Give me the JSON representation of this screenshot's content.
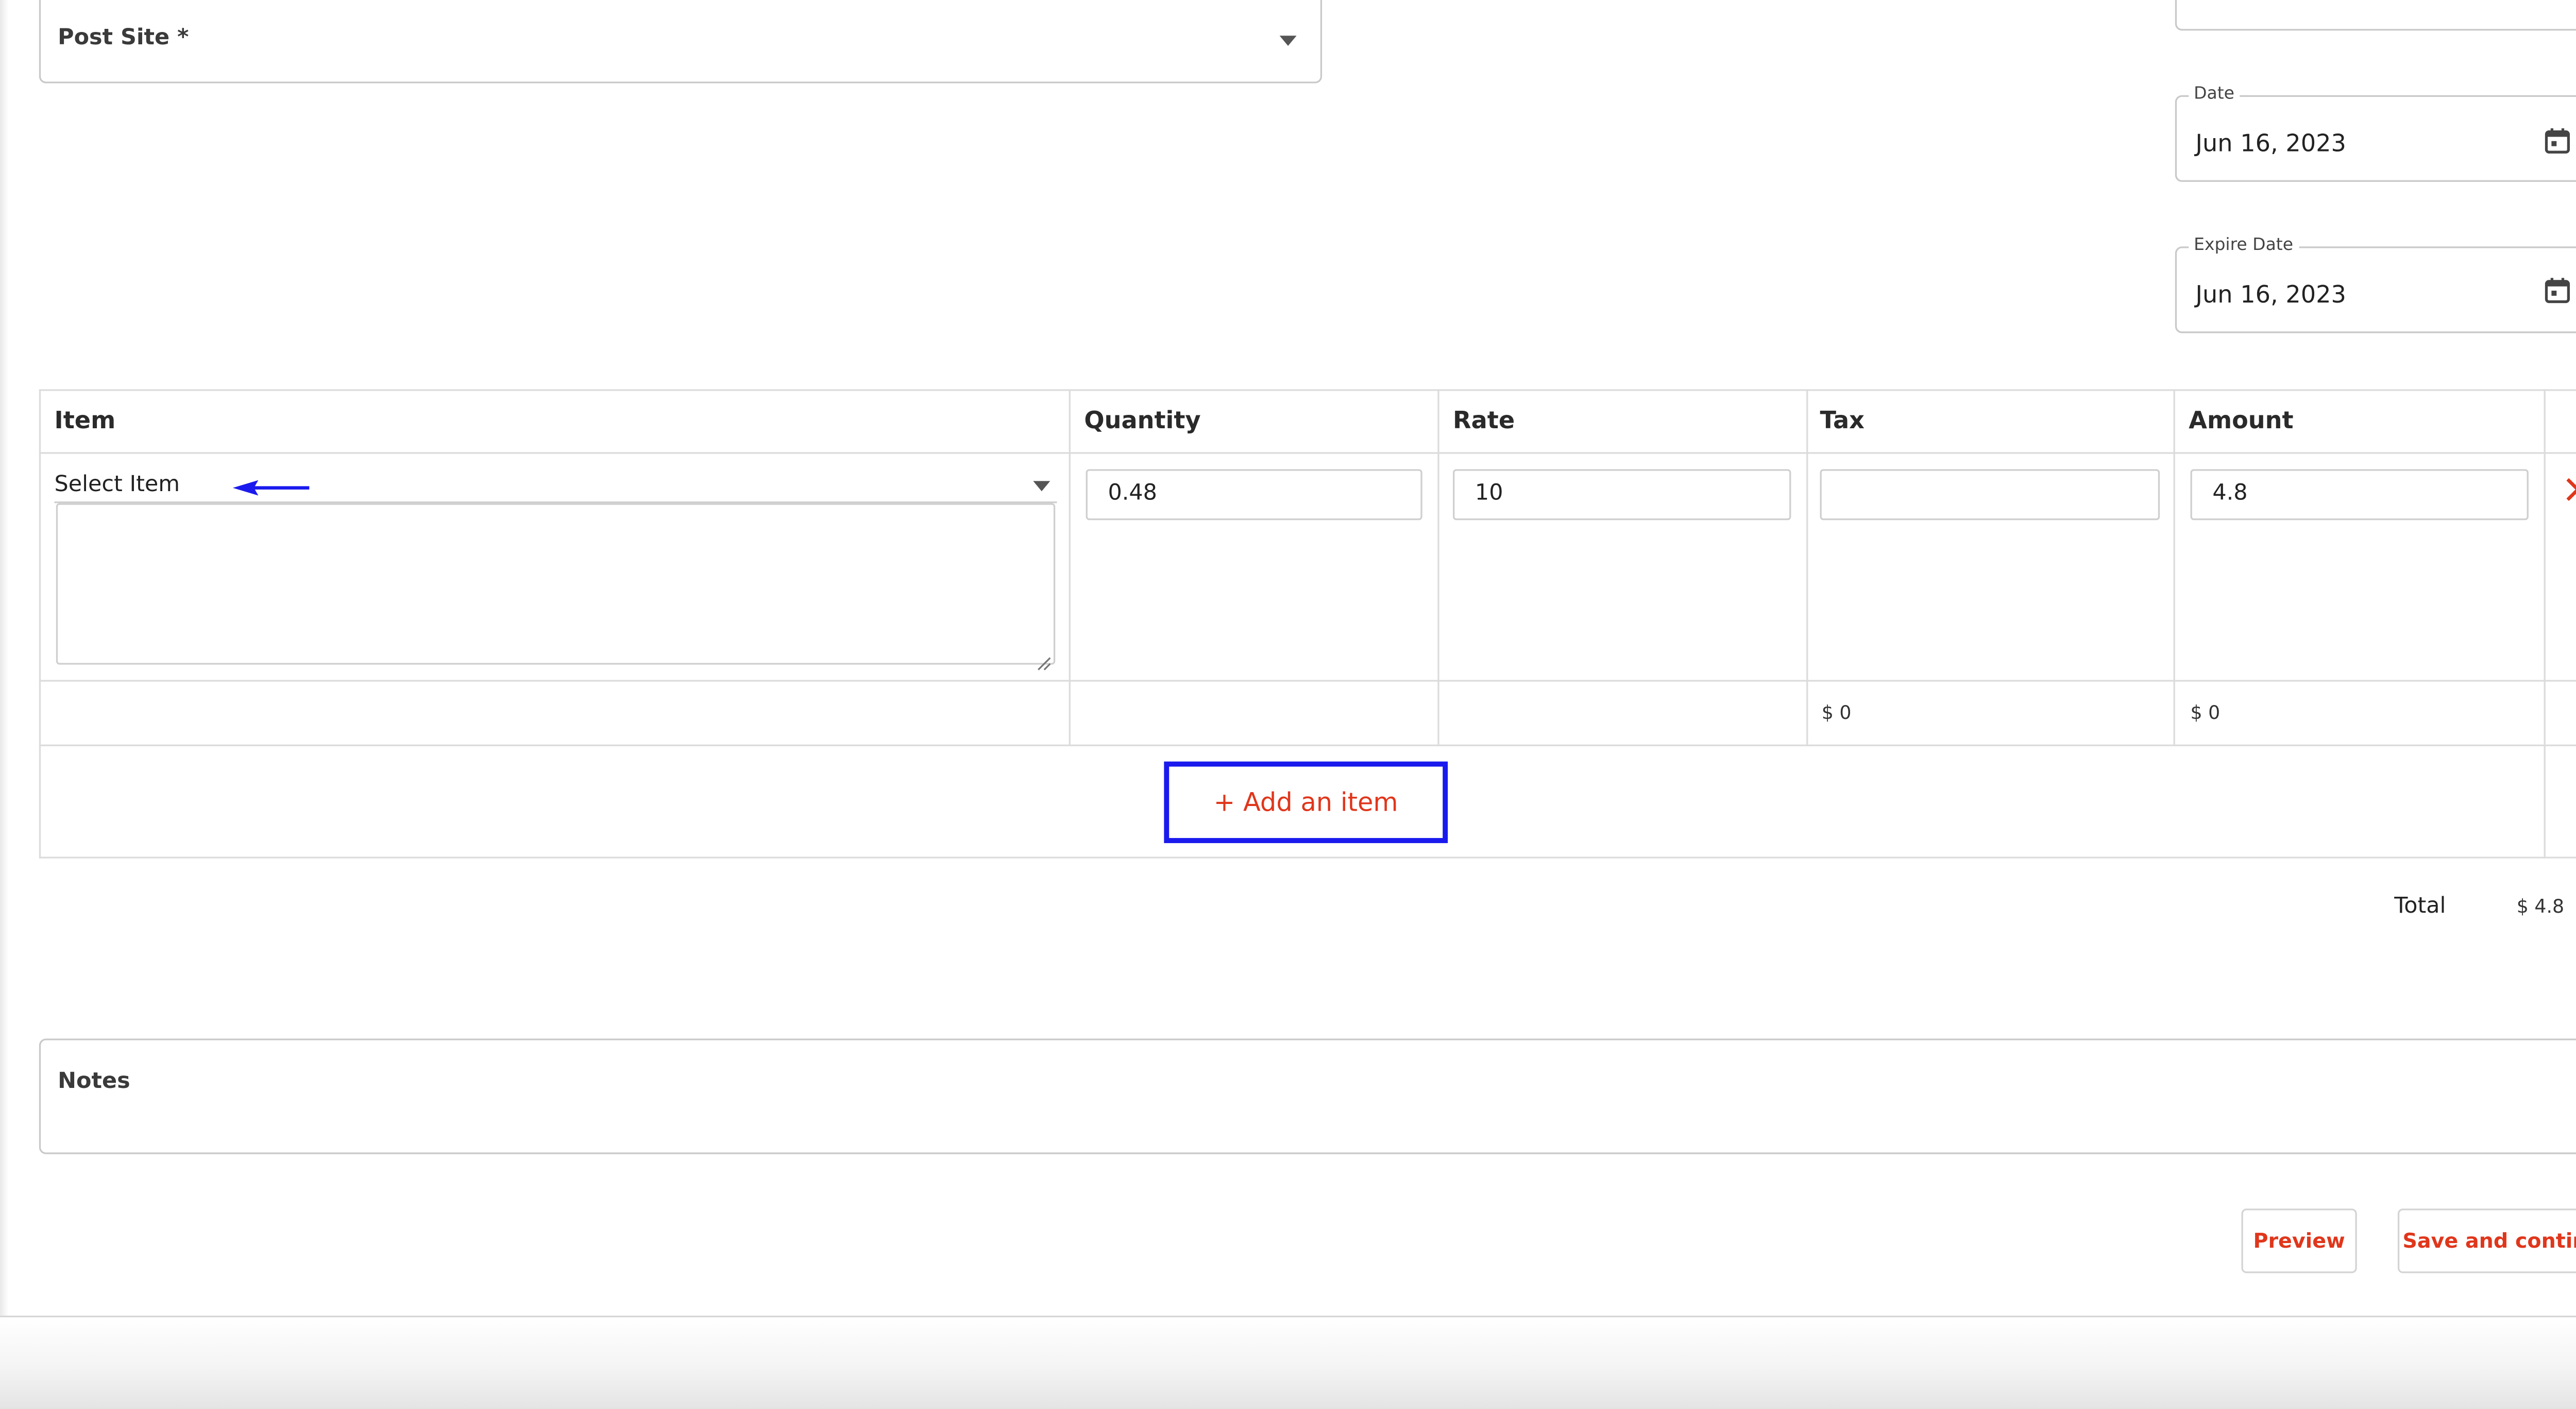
{
  "post_site": {
    "label": "Post Site *"
  },
  "date_field": {
    "label": "Date",
    "value": "Jun 16, 2023"
  },
  "expire_date_field": {
    "label": "Expire Date",
    "value": "Jun 16, 2023"
  },
  "items_table": {
    "columns": [
      "Item",
      "Quantity",
      "Rate",
      "Tax",
      "Amount"
    ],
    "row": {
      "item_placeholder": "Select Item",
      "quantity": "0.48",
      "rate": "10",
      "tax": "",
      "amount": "4.8"
    },
    "subtotals": {
      "tax": "$ 0",
      "amount": "$ 0"
    },
    "add_item_label": "+ Add an item"
  },
  "totals": {
    "label": "Total",
    "value": "$ 4.8"
  },
  "notes": {
    "label": "Notes"
  },
  "actions": {
    "preview_label": "Preview",
    "save_label": "Save and continue"
  },
  "colors": {
    "accent": "#e0361b",
    "highlight": "#1a1aee"
  },
  "icons": {
    "dropdown": "caret-down-icon",
    "calendar": "calendar-icon",
    "delete": "close-icon",
    "annotation": "arrow-left-icon"
  }
}
